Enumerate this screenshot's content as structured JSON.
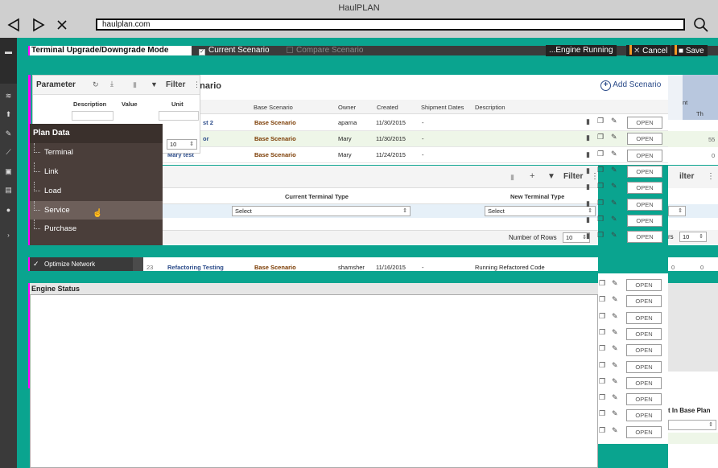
{
  "window": {
    "title": "HaulPLAN"
  },
  "browser": {
    "url": "haulplan.com"
  },
  "topbar": {
    "mode_title": "Terminal Upgrade/Downgrade Mode",
    "current_scenario": "Current Scenario",
    "compare_scenario": "Compare Scenario",
    "engine_running": "...Engine Running",
    "cancel": "Cancel",
    "save": "Save"
  },
  "scenario_panel": {
    "title_fragment": "enario",
    "add_scenario": "Add Scenario",
    "columns": [
      "Base Scenario",
      "Owner",
      "Created",
      "Shipment Dates",
      "Description"
    ],
    "rows": [
      {
        "name": "st 2",
        "base": "Base Scenario",
        "owner": "aparna",
        "created": "11/30/2015",
        "ship": "-",
        "desc": "",
        "open": "OPEN"
      },
      {
        "name": "or",
        "base": "Base Scenario",
        "owner": "Mary",
        "created": "11/30/2015",
        "ship": "-",
        "desc": "",
        "open": "OPEN"
      },
      {
        "name": "Mary test",
        "base": "Base Scenario",
        "owner": "Mary",
        "created": "11/24/2015",
        "ship": "-",
        "desc": "",
        "open": "OPEN"
      }
    ],
    "bottom_row": {
      "num": "23",
      "name": "Refactoring Testing",
      "base": "Base Scenario",
      "owner": "shamsher",
      "created": "11/16/2015",
      "ship": "-",
      "desc": "Running Refactored Code",
      "open": "OPEN"
    },
    "open_label": "OPEN"
  },
  "parameter_panel": {
    "title": "Parameter",
    "filter": "Filter",
    "columns": [
      "Description",
      "Value",
      "Unit"
    ],
    "page_size": "10"
  },
  "plan_menu": {
    "header": "Plan Data",
    "items": [
      "Terminal",
      "Link",
      "Load",
      "Service",
      "Purchase"
    ],
    "selected": "Service"
  },
  "terminal_panel": {
    "filter": "Filter",
    "col_current": "Current Terminal Type",
    "col_new": "New Terminal Type",
    "select_current": "Select",
    "select_new": "Select",
    "rows_label": "Number of Rows",
    "rows_value": "10"
  },
  "right_peek": {
    "col1": "nt",
    "col2": "Th",
    "v1": "55",
    "v2": "0",
    "filter": "ilter",
    "rows_frag": "rs",
    "rows_value": "10",
    "bottom_label": "t In Base Plan",
    "v3": "0",
    "v4": "0"
  },
  "optimize": {
    "label": "Optimize Network"
  },
  "engine": {
    "title": "Engine Status"
  },
  "colors": {
    "teal": "#0aa48f",
    "magenta": "#ff00ff",
    "orange": "#f39a26",
    "menu": "#4a3e3a"
  }
}
